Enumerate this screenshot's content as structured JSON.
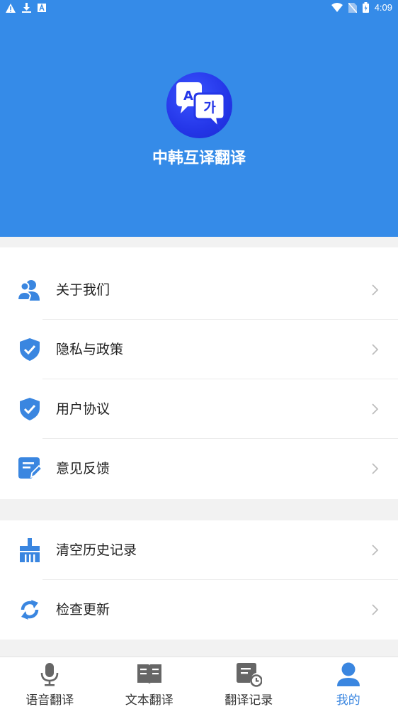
{
  "status_bar": {
    "time": "4:09"
  },
  "app": {
    "title": "中韩互译翻译",
    "logo_glyph_a": "A",
    "logo_glyph_b": "가"
  },
  "menu_group1": [
    {
      "label": "关于我们",
      "icon": "users-icon"
    },
    {
      "label": "隐私与政策",
      "icon": "shield-check-icon"
    },
    {
      "label": "用户协议",
      "icon": "shield-check-icon"
    },
    {
      "label": "意见反馈",
      "icon": "feedback-edit-icon"
    }
  ],
  "menu_group2": [
    {
      "label": "清空历史记录",
      "icon": "broom-icon"
    },
    {
      "label": "检查更新",
      "icon": "refresh-icon"
    }
  ],
  "tabbar": {
    "tabs": [
      {
        "label": "语音翻译",
        "icon": "microphone-icon"
      },
      {
        "label": "文本翻译",
        "icon": "book-icon"
      },
      {
        "label": "翻译记录",
        "icon": "history-doc-icon"
      },
      {
        "label": "我的",
        "icon": "user-icon",
        "active": true
      }
    ]
  },
  "colors": {
    "header": "#358be8",
    "accent": "#3a86e0",
    "icon_blue": "#3a86e0",
    "tab_gray": "#666666",
    "logo": "#2436e8"
  }
}
